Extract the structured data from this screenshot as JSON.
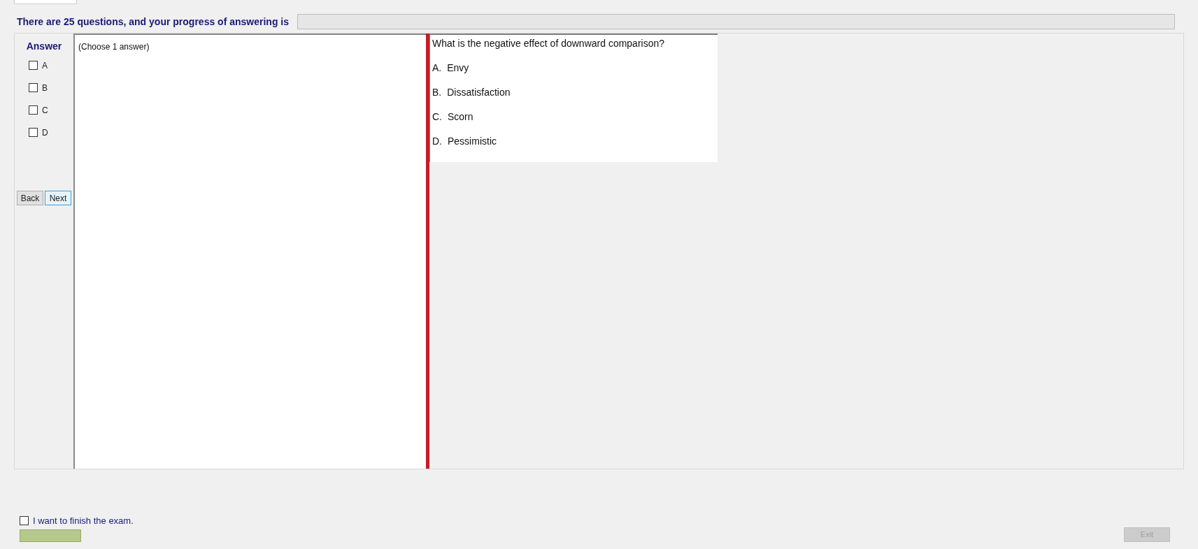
{
  "header": {
    "text": "There are 25 questions, and your progress of answering is",
    "progress": {
      "level": 0
    }
  },
  "answer_panel": {
    "title": "Answer",
    "options": [
      {
        "label": "A",
        "checked": false
      },
      {
        "label": "B",
        "checked": false
      },
      {
        "label": "C",
        "checked": false
      },
      {
        "label": "D",
        "checked": false
      }
    ],
    "buttons": [
      {
        "label": "Back",
        "selected": false
      },
      {
        "label": "Next",
        "selected": true
      }
    ]
  },
  "answer_hint": "(Choose 1 answer)",
  "question": {
    "text": "What is the negative effect of downward comparison?",
    "choices": [
      {
        "letter": "A.",
        "text": "Envy"
      },
      {
        "letter": "B.",
        "text": "Dissatisfaction"
      },
      {
        "letter": "C.",
        "text": "Scorn"
      },
      {
        "letter": "D.",
        "text": "Pessimistic"
      }
    ]
  },
  "finish": {
    "label": "I want to finish the exam.",
    "checked": false
  },
  "exit_button": {
    "label": "Exit",
    "disabled": true
  }
}
